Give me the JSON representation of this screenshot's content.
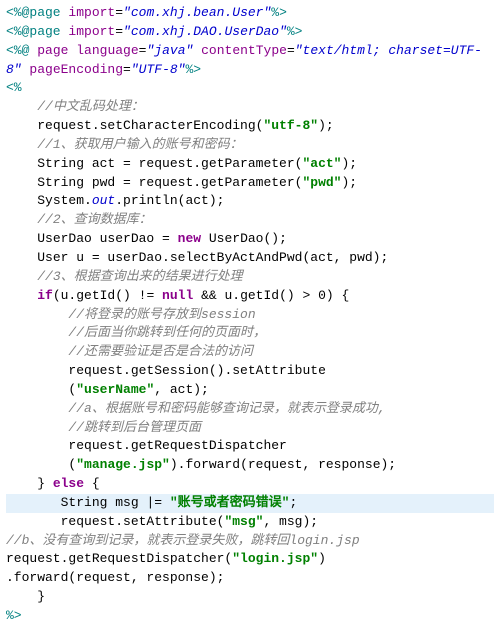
{
  "code": {
    "lines": [
      [
        {
          "cls": "tag",
          "t": "<%@page"
        },
        {
          "cls": "plain",
          "t": " "
        },
        {
          "cls": "attr",
          "t": "import"
        },
        {
          "cls": "plain",
          "t": "="
        },
        {
          "cls": "val",
          "t": "\"com.xhj.bean.User\""
        },
        {
          "cls": "tag",
          "t": "%>"
        }
      ],
      [
        {
          "cls": "tag",
          "t": "<%@page"
        },
        {
          "cls": "plain",
          "t": " "
        },
        {
          "cls": "attr",
          "t": "import"
        },
        {
          "cls": "plain",
          "t": "="
        },
        {
          "cls": "val",
          "t": "\"com.xhj.DAO.UserDao\""
        },
        {
          "cls": "tag",
          "t": "%>"
        }
      ],
      [
        {
          "cls": "tag",
          "t": "<%@"
        },
        {
          "cls": "plain",
          "t": " "
        },
        {
          "cls": "attr",
          "t": "page"
        },
        {
          "cls": "plain",
          "t": " "
        },
        {
          "cls": "attr",
          "t": "language"
        },
        {
          "cls": "plain",
          "t": "="
        },
        {
          "cls": "val",
          "t": "\"java\""
        },
        {
          "cls": "plain",
          "t": " "
        },
        {
          "cls": "attr",
          "t": "contentType"
        },
        {
          "cls": "plain",
          "t": "="
        },
        {
          "cls": "val",
          "t": "\"text/html; charset=UTF-8\""
        },
        {
          "cls": "plain",
          "t": " "
        },
        {
          "cls": "attr",
          "t": "pageEncoding"
        },
        {
          "cls": "plain",
          "t": "="
        },
        {
          "cls": "val",
          "t": "\"UTF-8\""
        },
        {
          "cls": "tag",
          "t": "%>"
        }
      ],
      [
        {
          "cls": "tag",
          "t": "<%"
        }
      ],
      [
        {
          "cls": "plain",
          "t": ""
        }
      ],
      [
        {
          "cls": "plain",
          "t": "    "
        },
        {
          "cls": "cmt",
          "t": "//中文乱码处理："
        }
      ],
      [
        {
          "cls": "plain",
          "t": "    request.setCharacterEncoding("
        },
        {
          "cls": "str",
          "t": "\"utf-8\""
        },
        {
          "cls": "plain",
          "t": ");"
        }
      ],
      [
        {
          "cls": "plain",
          "t": "    "
        },
        {
          "cls": "cmt",
          "t": "//1、获取用户输入的账号和密码："
        }
      ],
      [
        {
          "cls": "plain",
          "t": "    String act = request.getParameter("
        },
        {
          "cls": "str",
          "t": "\"act\""
        },
        {
          "cls": "plain",
          "t": ");"
        }
      ],
      [
        {
          "cls": "plain",
          "t": "    String pwd = request.getParameter("
        },
        {
          "cls": "str",
          "t": "\"pwd\""
        },
        {
          "cls": "plain",
          "t": ");"
        }
      ],
      [
        {
          "cls": "plain",
          "t": "    System."
        },
        {
          "cls": "val",
          "t": "out"
        },
        {
          "cls": "plain",
          "t": ".println(act);"
        }
      ],
      [
        {
          "cls": "plain",
          "t": "    "
        },
        {
          "cls": "cmt",
          "t": "//2、查询数据库："
        }
      ],
      [
        {
          "cls": "plain",
          "t": "    UserDao userDao = "
        },
        {
          "cls": "kw",
          "t": "new"
        },
        {
          "cls": "plain",
          "t": " UserDao();"
        }
      ],
      [
        {
          "cls": "plain",
          "t": "    User u = userDao.selectByActAndPwd(act, pwd);"
        }
      ],
      [
        {
          "cls": "plain",
          "t": "    "
        },
        {
          "cls": "cmt",
          "t": "//3、根据查询出来的结果进行处理"
        }
      ],
      [
        {
          "cls": "plain",
          "t": "    "
        },
        {
          "cls": "kw",
          "t": "if"
        },
        {
          "cls": "plain",
          "t": "(u.getId() != "
        },
        {
          "cls": "kw",
          "t": "null"
        },
        {
          "cls": "plain",
          "t": " && u.getId() > "
        },
        {
          "cls": "plain",
          "t": "0"
        },
        {
          "cls": "plain",
          "t": ") {"
        }
      ],
      [
        {
          "cls": "plain",
          "t": "        "
        },
        {
          "cls": "cmt",
          "t": "//将登录的账号存放到session"
        }
      ],
      [
        {
          "cls": "plain",
          "t": "        "
        },
        {
          "cls": "cmt",
          "t": "//后面当你跳转到任何的页面时，"
        }
      ],
      [
        {
          "cls": "plain",
          "t": "        "
        },
        {
          "cls": "cmt",
          "t": "//还需要验证是否是合法的访问"
        }
      ],
      [
        {
          "cls": "plain",
          "t": "        request.getSession().setAttribute"
        }
      ],
      [
        {
          "cls": "plain",
          "t": "        ("
        },
        {
          "cls": "str",
          "t": "\"userName\""
        },
        {
          "cls": "plain",
          "t": ", act);"
        }
      ],
      [
        {
          "cls": "plain",
          "t": "        "
        },
        {
          "cls": "cmt",
          "t": "//a、根据账号和密码能够查询记录，就表示登录成功,"
        }
      ],
      [
        {
          "cls": "plain",
          "t": "        "
        },
        {
          "cls": "cmt",
          "t": "//跳转到后台管理页面"
        }
      ],
      [
        {
          "cls": "plain",
          "t": "        request.getRequestDispatcher"
        }
      ],
      [
        {
          "cls": "plain",
          "t": "        ("
        },
        {
          "cls": "str",
          "t": "\"manage.jsp\""
        },
        {
          "cls": "plain",
          "t": ").forward(request, response);"
        }
      ],
      [
        {
          "cls": "plain",
          "t": "    } "
        },
        {
          "cls": "kw",
          "t": "else"
        },
        {
          "cls": "plain",
          "t": " {"
        }
      ],
      [
        {
          "hl": true,
          "cls": "plain",
          "t": "       String msg "
        },
        {
          "cls": "plain",
          "t": "|"
        },
        {
          "cls": "plain",
          "t": "= "
        },
        {
          "cls": "str",
          "t": "\"账号或者密码错误\""
        },
        {
          "cls": "plain",
          "t": ";"
        }
      ],
      [
        {
          "cls": "plain",
          "t": "       request.setAttribute("
        },
        {
          "cls": "str",
          "t": "\"msg\""
        },
        {
          "cls": "plain",
          "t": ", msg);"
        }
      ],
      [
        {
          "cls": "cmt",
          "t": "//b、没有查询到记录，就表示登录失败，跳转回login.jsp"
        }
      ],
      [
        {
          "cls": "plain",
          "t": "request.getRequestDispatcher("
        },
        {
          "cls": "str",
          "t": "\"login.jsp\""
        },
        {
          "cls": "plain",
          "t": ")"
        }
      ],
      [
        {
          "cls": "plain",
          "t": ".forward(request, response);"
        }
      ],
      [
        {
          "cls": "plain",
          "t": "    }"
        }
      ],
      [
        {
          "cls": "plain",
          "t": ""
        }
      ],
      [
        {
          "cls": "tag",
          "t": "%>"
        }
      ]
    ]
  }
}
